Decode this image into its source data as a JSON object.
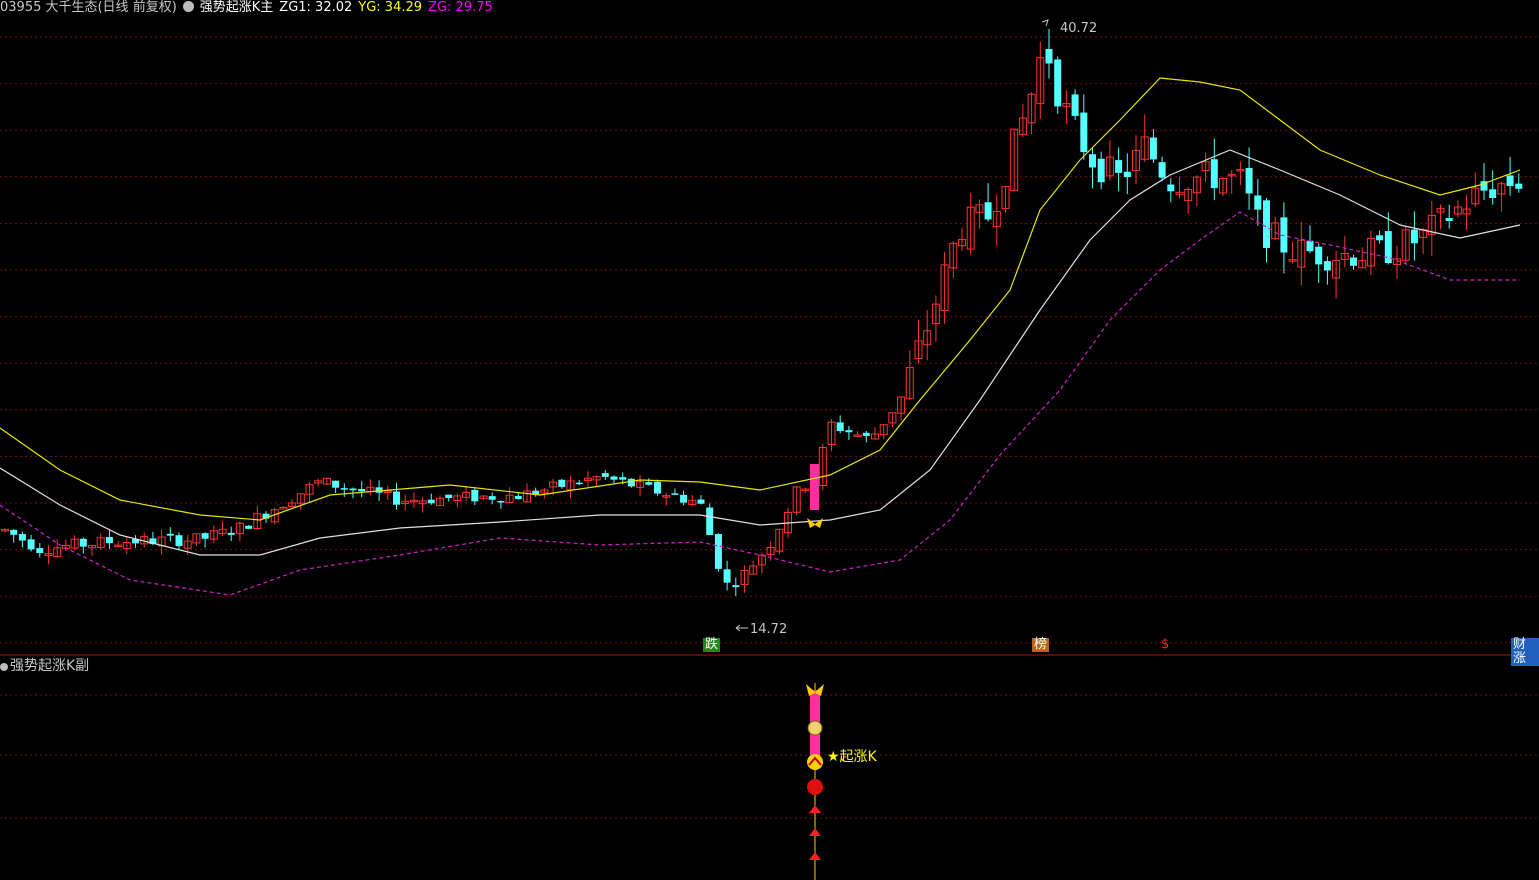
{
  "header": {
    "code_name": "03955 大千生态(日线 前复权)",
    "indicator_name": "强势起涨K主",
    "zg1_text": "ZG1: 32.02",
    "yg_text": "YG: 34.29",
    "zg_text": "ZG: 29.75"
  },
  "sub_panel": {
    "title": "强势起涨K副",
    "signal_label": "起涨K"
  },
  "annotations": {
    "high_label": "40.72",
    "low_label": "14.72"
  },
  "markers": [
    {
      "text": "跌",
      "color": "#1a8a1a"
    },
    {
      "text": "榜",
      "color": "#b5651d"
    },
    {
      "text": "$",
      "color": "#ff2020"
    },
    {
      "text": "财涨",
      "color": "#2060c0"
    }
  ],
  "colors": {
    "up": "#ff3232",
    "down": "#54ffff",
    "signal_bar": "#ff2fa0",
    "yellow_line": "#e6e600",
    "white_line": "#e0e0e0",
    "dashed_line": "#cc22cc",
    "grid": "#7a1010",
    "divider": "#b01010"
  },
  "chart_data": {
    "type": "candlestick",
    "price_range": [
      14.72,
      40.72
    ],
    "high": 40.72,
    "low": 14.72,
    "series": [
      {
        "name": "ZG1",
        "value_last": 32.02
      },
      {
        "name": "YG",
        "value_last": 34.29
      },
      {
        "name": "ZG",
        "value_last": 29.75
      }
    ]
  }
}
